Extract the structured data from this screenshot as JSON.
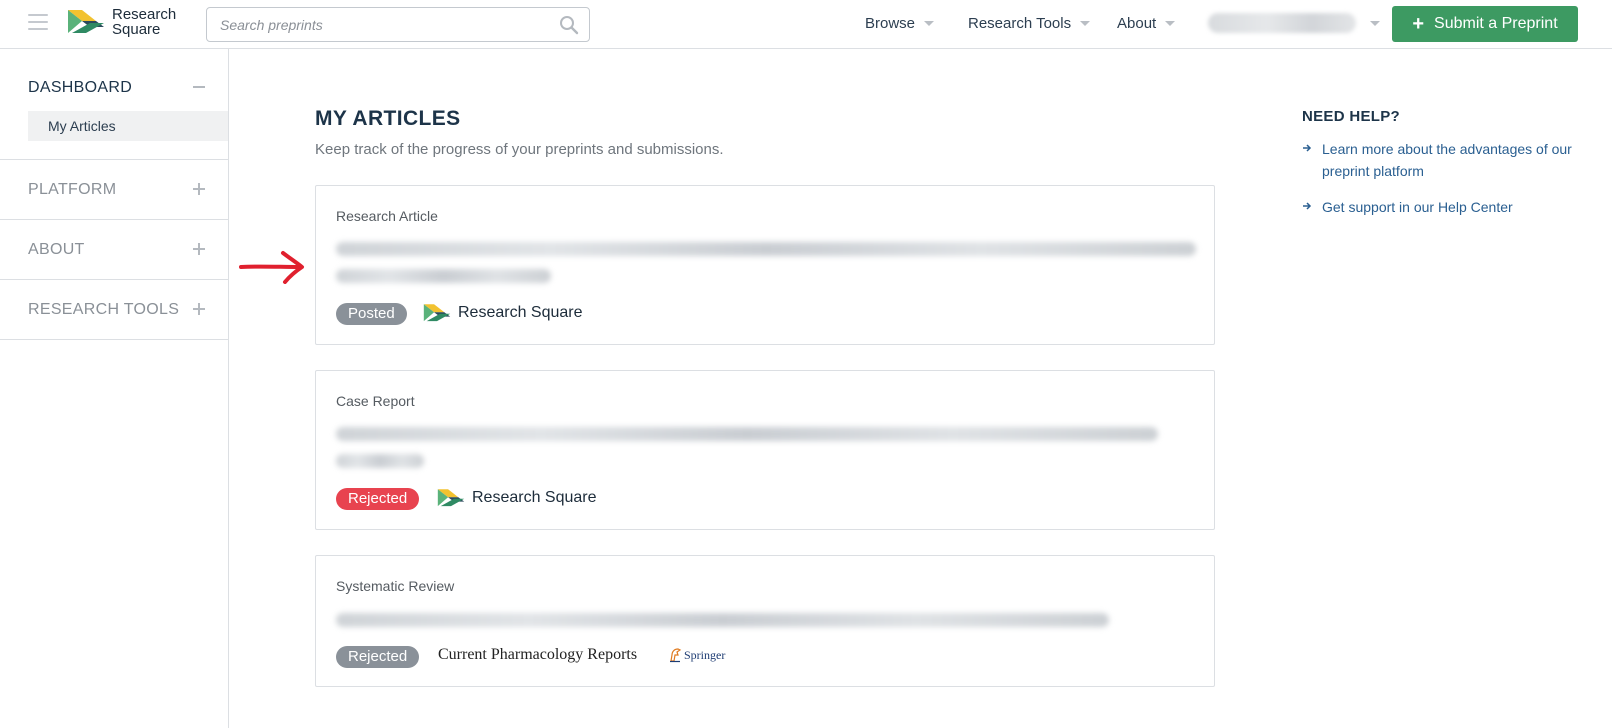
{
  "header": {
    "logo_line1": "Research",
    "logo_line2": "Square",
    "search_placeholder": "Search preprints",
    "nav": [
      {
        "label": "Browse"
      },
      {
        "label": "Research Tools"
      },
      {
        "label": "About"
      }
    ],
    "submit_label": "Submit a Preprint"
  },
  "sidebar": {
    "sections": [
      {
        "label": "DASHBOARD",
        "state": "expanded",
        "items": [
          {
            "label": "My Articles"
          }
        ]
      },
      {
        "label": "PLATFORM",
        "state": "collapsed"
      },
      {
        "label": "ABOUT",
        "state": "collapsed"
      },
      {
        "label": "RESEARCH TOOLS",
        "state": "collapsed"
      }
    ]
  },
  "main": {
    "title": "MY ARTICLES",
    "subtitle": "Keep track of the progress of your preprints and submissions.",
    "articles": [
      {
        "type": "Research Article",
        "status": "Posted",
        "status_color": "#8a9199",
        "venue": "Research Square"
      },
      {
        "type": "Case Report",
        "status": "Rejected",
        "status_color": "#e8434f",
        "venue": "Research Square"
      },
      {
        "type": "Systematic Review",
        "status": "Rejected",
        "status_color": "#8a9199",
        "venue": "Current Pharmacology Reports",
        "publisher": "Springer"
      }
    ]
  },
  "help": {
    "title": "NEED HELP?",
    "links": [
      {
        "label": "Learn more about the advantages of our preprint platform"
      },
      {
        "label": "Get support in our Help Center"
      }
    ]
  },
  "colors": {
    "accent_green": "#3d9a62",
    "heading": "#1d3449",
    "link": "#2a5f91",
    "annotation_arrow": "#e0202e"
  }
}
